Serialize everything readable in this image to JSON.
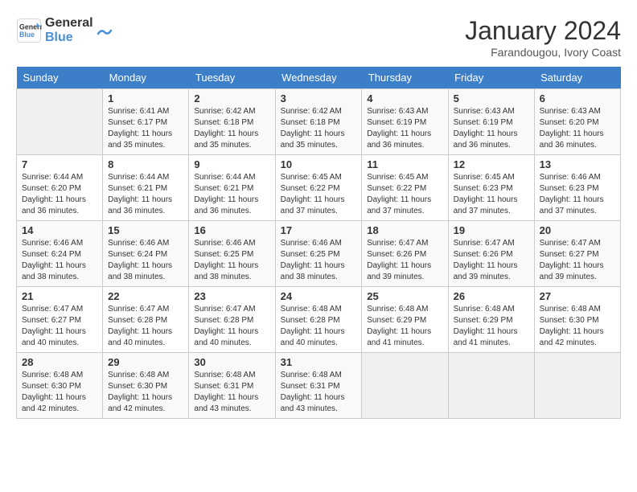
{
  "header": {
    "logo_line1": "General",
    "logo_line2": "Blue",
    "month_year": "January 2024",
    "location": "Farandougou, Ivory Coast"
  },
  "weekdays": [
    "Sunday",
    "Monday",
    "Tuesday",
    "Wednesday",
    "Thursday",
    "Friday",
    "Saturday"
  ],
  "weeks": [
    [
      {
        "day": "",
        "sunrise": "",
        "sunset": "",
        "daylight": ""
      },
      {
        "day": "1",
        "sunrise": "6:41 AM",
        "sunset": "6:17 PM",
        "daylight": "11 hours and 35 minutes."
      },
      {
        "day": "2",
        "sunrise": "6:42 AM",
        "sunset": "6:18 PM",
        "daylight": "11 hours and 35 minutes."
      },
      {
        "day": "3",
        "sunrise": "6:42 AM",
        "sunset": "6:18 PM",
        "daylight": "11 hours and 35 minutes."
      },
      {
        "day": "4",
        "sunrise": "6:43 AM",
        "sunset": "6:19 PM",
        "daylight": "11 hours and 36 minutes."
      },
      {
        "day": "5",
        "sunrise": "6:43 AM",
        "sunset": "6:19 PM",
        "daylight": "11 hours and 36 minutes."
      },
      {
        "day": "6",
        "sunrise": "6:43 AM",
        "sunset": "6:20 PM",
        "daylight": "11 hours and 36 minutes."
      }
    ],
    [
      {
        "day": "7",
        "sunrise": "6:44 AM",
        "sunset": "6:20 PM",
        "daylight": "11 hours and 36 minutes."
      },
      {
        "day": "8",
        "sunrise": "6:44 AM",
        "sunset": "6:21 PM",
        "daylight": "11 hours and 36 minutes."
      },
      {
        "day": "9",
        "sunrise": "6:44 AM",
        "sunset": "6:21 PM",
        "daylight": "11 hours and 36 minutes."
      },
      {
        "day": "10",
        "sunrise": "6:45 AM",
        "sunset": "6:22 PM",
        "daylight": "11 hours and 37 minutes."
      },
      {
        "day": "11",
        "sunrise": "6:45 AM",
        "sunset": "6:22 PM",
        "daylight": "11 hours and 37 minutes."
      },
      {
        "day": "12",
        "sunrise": "6:45 AM",
        "sunset": "6:23 PM",
        "daylight": "11 hours and 37 minutes."
      },
      {
        "day": "13",
        "sunrise": "6:46 AM",
        "sunset": "6:23 PM",
        "daylight": "11 hours and 37 minutes."
      }
    ],
    [
      {
        "day": "14",
        "sunrise": "6:46 AM",
        "sunset": "6:24 PM",
        "daylight": "11 hours and 38 minutes."
      },
      {
        "day": "15",
        "sunrise": "6:46 AM",
        "sunset": "6:24 PM",
        "daylight": "11 hours and 38 minutes."
      },
      {
        "day": "16",
        "sunrise": "6:46 AM",
        "sunset": "6:25 PM",
        "daylight": "11 hours and 38 minutes."
      },
      {
        "day": "17",
        "sunrise": "6:46 AM",
        "sunset": "6:25 PM",
        "daylight": "11 hours and 38 minutes."
      },
      {
        "day": "18",
        "sunrise": "6:47 AM",
        "sunset": "6:26 PM",
        "daylight": "11 hours and 39 minutes."
      },
      {
        "day": "19",
        "sunrise": "6:47 AM",
        "sunset": "6:26 PM",
        "daylight": "11 hours and 39 minutes."
      },
      {
        "day": "20",
        "sunrise": "6:47 AM",
        "sunset": "6:27 PM",
        "daylight": "11 hours and 39 minutes."
      }
    ],
    [
      {
        "day": "21",
        "sunrise": "6:47 AM",
        "sunset": "6:27 PM",
        "daylight": "11 hours and 40 minutes."
      },
      {
        "day": "22",
        "sunrise": "6:47 AM",
        "sunset": "6:28 PM",
        "daylight": "11 hours and 40 minutes."
      },
      {
        "day": "23",
        "sunrise": "6:47 AM",
        "sunset": "6:28 PM",
        "daylight": "11 hours and 40 minutes."
      },
      {
        "day": "24",
        "sunrise": "6:48 AM",
        "sunset": "6:28 PM",
        "daylight": "11 hours and 40 minutes."
      },
      {
        "day": "25",
        "sunrise": "6:48 AM",
        "sunset": "6:29 PM",
        "daylight": "11 hours and 41 minutes."
      },
      {
        "day": "26",
        "sunrise": "6:48 AM",
        "sunset": "6:29 PM",
        "daylight": "11 hours and 41 minutes."
      },
      {
        "day": "27",
        "sunrise": "6:48 AM",
        "sunset": "6:30 PM",
        "daylight": "11 hours and 42 minutes."
      }
    ],
    [
      {
        "day": "28",
        "sunrise": "6:48 AM",
        "sunset": "6:30 PM",
        "daylight": "11 hours and 42 minutes."
      },
      {
        "day": "29",
        "sunrise": "6:48 AM",
        "sunset": "6:30 PM",
        "daylight": "11 hours and 42 minutes."
      },
      {
        "day": "30",
        "sunrise": "6:48 AM",
        "sunset": "6:31 PM",
        "daylight": "11 hours and 43 minutes."
      },
      {
        "day": "31",
        "sunrise": "6:48 AM",
        "sunset": "6:31 PM",
        "daylight": "11 hours and 43 minutes."
      },
      {
        "day": "",
        "sunrise": "",
        "sunset": "",
        "daylight": ""
      },
      {
        "day": "",
        "sunrise": "",
        "sunset": "",
        "daylight": ""
      },
      {
        "day": "",
        "sunrise": "",
        "sunset": "",
        "daylight": ""
      }
    ]
  ],
  "labels": {
    "sunrise_prefix": "Sunrise: ",
    "sunset_prefix": "Sunset: ",
    "daylight_prefix": "Daylight: "
  }
}
